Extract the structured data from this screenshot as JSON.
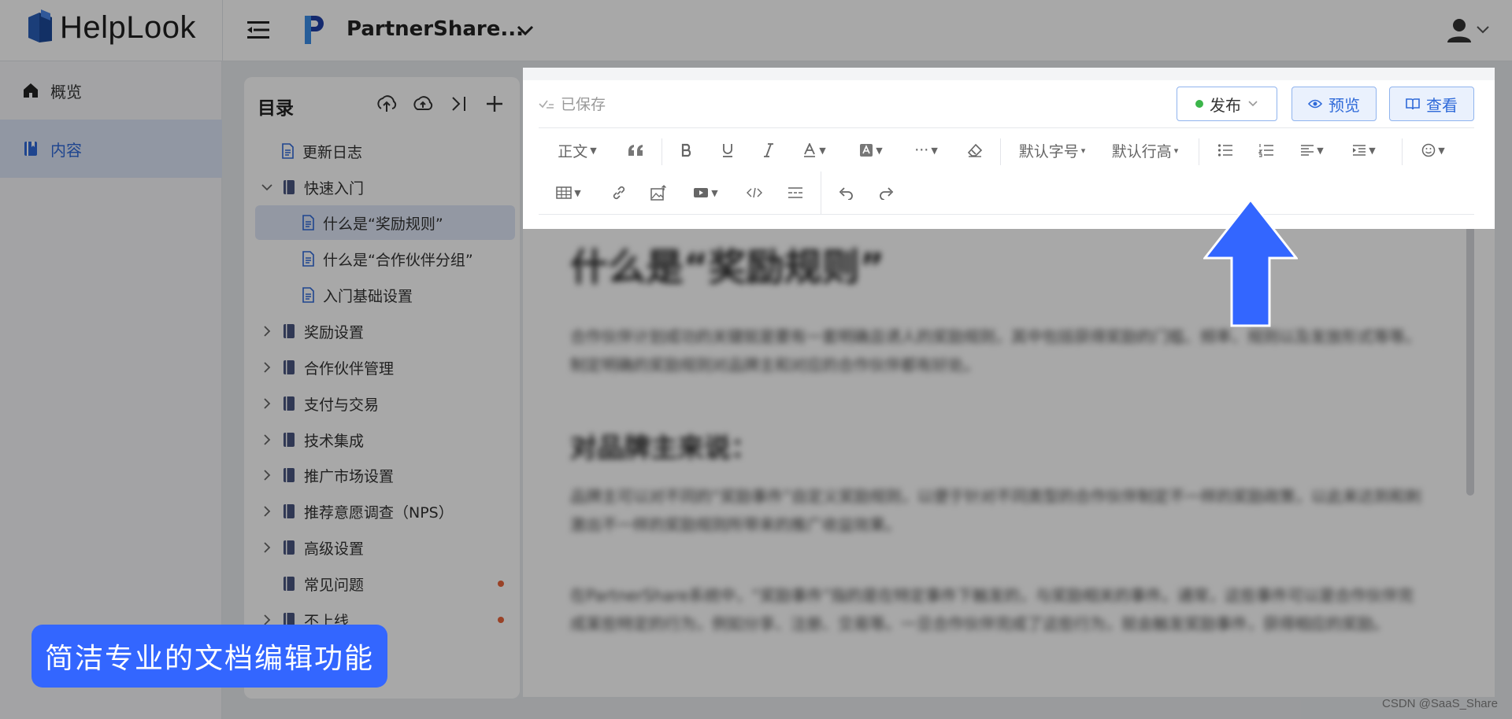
{
  "app": {
    "logo_text": "HelpLook"
  },
  "header": {
    "project_name": "PartnerShare..."
  },
  "sidebar": {
    "items": [
      {
        "label": "概览"
      },
      {
        "label": "内容"
      }
    ]
  },
  "toc": {
    "title": "目录",
    "items": [
      {
        "label": "更新日志"
      },
      {
        "label": "快速入门"
      },
      {
        "label": "什么是“奖励规则”"
      },
      {
        "label": "什么是“合作伙伴分组”"
      },
      {
        "label": "入门基础设置"
      },
      {
        "label": "奖励设置"
      },
      {
        "label": "合作伙伴管理"
      },
      {
        "label": "支付与交易"
      },
      {
        "label": "技术集成"
      },
      {
        "label": "推广市场设置"
      },
      {
        "label": "推荐意愿调查（NPS）"
      },
      {
        "label": "高级设置"
      },
      {
        "label": "常见问题"
      },
      {
        "label": "不上线"
      }
    ]
  },
  "editor": {
    "saved_label": "已保存",
    "publish_label": "发布",
    "preview_label": "预览",
    "view_label": "查看",
    "toolbar": {
      "paragraph": "正文",
      "font_size": "默认字号",
      "line_height": "默认行高",
      "more": "···"
    }
  },
  "document": {
    "title": "什么是“奖励规则”",
    "intro": "合作伙伴计划成功的关键就是要有一套明确且诱人的奖励规则，其中包括获得奖励的门槛、频率、规则以及发放形式等等。制定明确的奖励规则对品牌主和对应的合作伙伴都有好处。",
    "section_title": "对品牌主来说：",
    "section_p1": "品牌主可以对不同的“奖励事件”自定义奖励规则，以便于针对不同类型的合作伙伴制定不一样的奖励政策，以此来达到和刺激出不一样的奖励规则所带来的推广收益效果。",
    "section_p2": "在PartnerShare系统中，“奖励事件”指的是在特定事件下触发的，与奖励相关的事件。通常，这些事件可以是合作伙伴完成某些特定的行为，例如分享、注册、交易等。一旦合作伙伴完成了这些行为，就会触发奖励事件，获得相应的奖励。"
  },
  "caption": {
    "text": "简洁专业的文档编辑功能"
  },
  "watermark": {
    "text": "CSDN @SaaS_Share"
  },
  "colors": {
    "accent": "#2f6ad9",
    "highlight": "#3366ff",
    "publish_dot": "#3bb54a"
  }
}
